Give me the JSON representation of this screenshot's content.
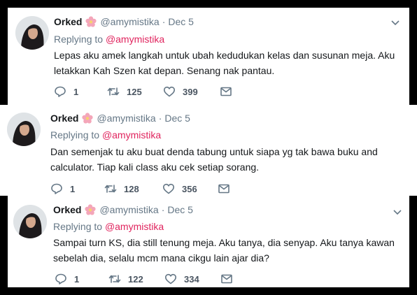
{
  "tweets": [
    {
      "name": "Orked",
      "handle": "@amymistika",
      "separator": "·",
      "date": "Dec 5",
      "replying_prefix": "Replying to",
      "replying_user": "@amymistika",
      "text_line1": "Lepas aku amek langkah untuk ubah kedudukan kelas dan susunan meja. Aku",
      "text_line2": "letakkan Kah Szen kat depan.  Senang nak pantau.",
      "replies": "1",
      "retweets": "125",
      "likes": "399"
    },
    {
      "name": "Orked",
      "handle": "@amymistika",
      "separator": "·",
      "date": "Dec 5",
      "replying_prefix": "Replying to",
      "replying_user": "@amymistika",
      "text_line1": "Dan semenjak tu aku buat denda tabung untuk siapa yg tak bawa buku and",
      "text_line2": "calculator. Tiap kali class aku cek setiap sorang.",
      "replies": "1",
      "retweets": "128",
      "likes": "356"
    },
    {
      "name": "Orked",
      "handle": "@amymistika",
      "separator": "·",
      "date": "Dec 5",
      "replying_prefix": "Replying to",
      "replying_user": "@amymistika",
      "text_line1": "Sampai turn KS, dia still tenung meja. Aku tanya, dia senyap. Aku tanya kawan",
      "text_line2": "sebelah dia, selalu mcm mana cikgu lain ajar dia?",
      "replies": "1",
      "retweets": "122",
      "likes": "334"
    }
  ],
  "colors": {
    "text": "#14171a",
    "muted": "#657786",
    "mention": "#e0245e",
    "flower": "#f4a6b9",
    "icon": "#657786"
  },
  "icons": [
    "reply-icon",
    "retweet-icon",
    "like-icon",
    "direct-message-icon",
    "chevron-down-icon",
    "flower-emoji-icon"
  ]
}
